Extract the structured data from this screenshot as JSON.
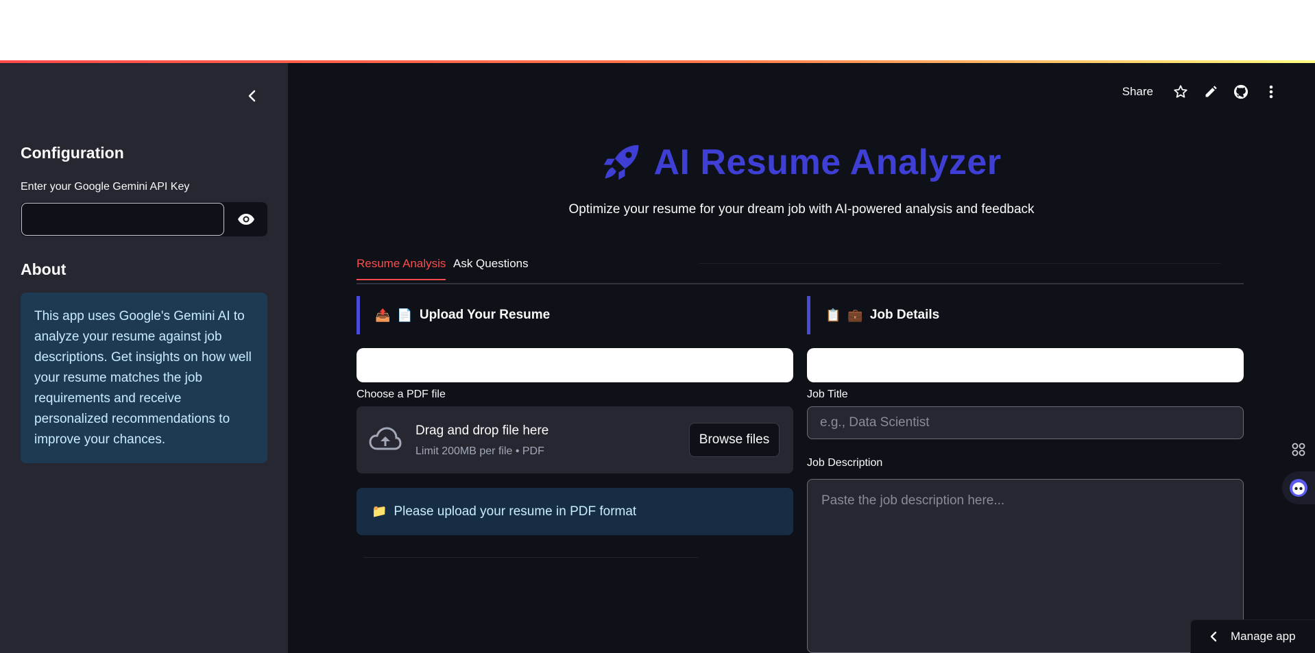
{
  "sidebar": {
    "config_heading": "Configuration",
    "api_key_label": "Enter your Google Gemini API Key",
    "api_key_value": "",
    "about_heading": "About",
    "about_text": "This app uses Google's Gemini AI to analyze your resume against job descriptions. Get insights on how well your resume matches the job requirements and receive personalized recommendations to improve your chances."
  },
  "toolbar": {
    "share_label": "Share",
    "icons": [
      "star-icon",
      "pencil-icon",
      "github-icon",
      "more-vertical-icon"
    ]
  },
  "header": {
    "title": "AI Resume Analyzer",
    "title_icon": "rocket-icon",
    "subtitle": "Optimize your resume for your dream job with AI-powered analysis and feedback"
  },
  "tabs": [
    {
      "label": "Resume Analysis",
      "active": true
    },
    {
      "label": "Ask Questions",
      "active": false
    }
  ],
  "upload": {
    "heading": "Upload Your Resume",
    "heading_emojis": [
      "📤",
      "📄"
    ],
    "file_label": "Choose a PDF file",
    "drag_title": "Drag and drop file here",
    "limit_text": "Limit 200MB per file • PDF",
    "browse_label": "Browse files",
    "info_emoji": "📁",
    "info_text": "Please upload your resume in PDF format"
  },
  "job": {
    "heading": "Job Details",
    "heading_emojis": [
      "📋",
      "💼"
    ],
    "title_label": "Job Title",
    "title_placeholder": "e.g., Data Scientist",
    "description_label": "Job Description",
    "description_placeholder": "Paste the job description here..."
  },
  "manage_app_label": "Manage app",
  "colors": {
    "accent_red": "#ff4b4b",
    "title_blue": "#3f3fd6",
    "sidebar_bg": "#262730",
    "main_bg": "#0e1117",
    "info_bg": "#172d43"
  }
}
